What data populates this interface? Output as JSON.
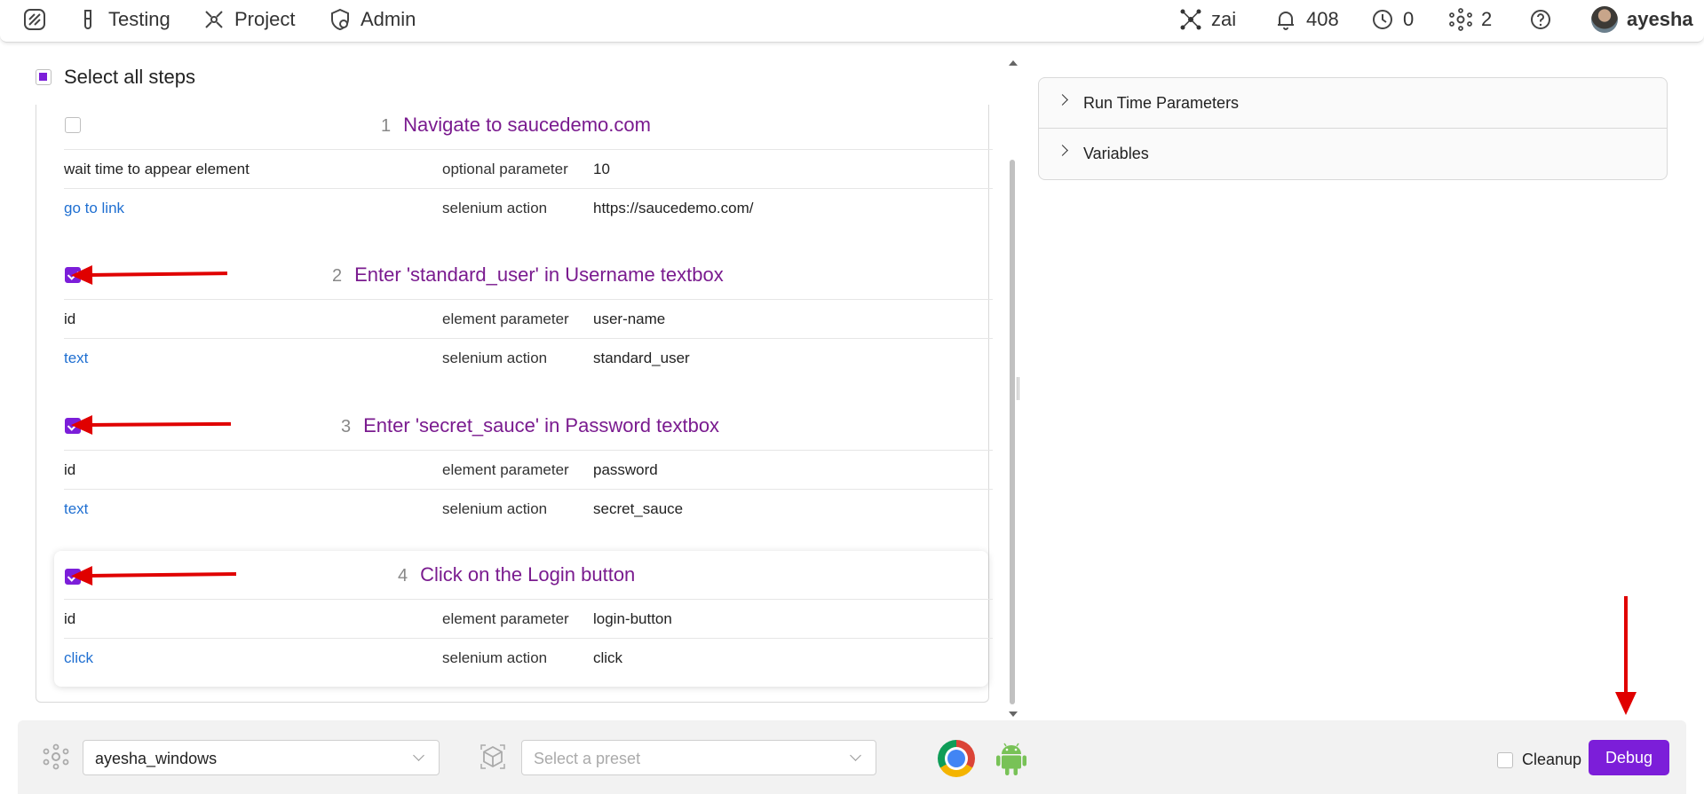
{
  "nav": {
    "testing_label": "Testing",
    "project_label": "Project",
    "admin_label": "Admin",
    "zai_label": "zai",
    "notifications_count": "408",
    "history_count": "0",
    "agents_count": "2",
    "user_name": "ayesha"
  },
  "steps_panel": {
    "select_all_label": "Select all steps",
    "steps": [
      {
        "number": "1",
        "title": "Navigate to saucedemo.com",
        "checked": false,
        "rows": [
          {
            "name": "wait time to appear element",
            "type": "optional parameter",
            "value": "10"
          },
          {
            "name": "go to link",
            "type": "selenium action",
            "value": "https://saucedemo.com/"
          }
        ]
      },
      {
        "number": "2",
        "title": "Enter 'standard_user' in Username textbox",
        "checked": true,
        "rows": [
          {
            "name": "id",
            "type": "element parameter",
            "value": "user-name"
          },
          {
            "name": "text",
            "type": "selenium action",
            "value": "standard_user"
          }
        ]
      },
      {
        "number": "3",
        "title": "Enter 'secret_sauce' in Password textbox",
        "checked": true,
        "rows": [
          {
            "name": "id",
            "type": "element parameter",
            "value": "password"
          },
          {
            "name": "text",
            "type": "selenium action",
            "value": "secret_sauce"
          }
        ]
      },
      {
        "number": "4",
        "title": "Click on the Login button",
        "checked": true,
        "rows": [
          {
            "name": "id",
            "type": "element parameter",
            "value": "login-button"
          },
          {
            "name": "click",
            "type": "selenium action",
            "value": "click"
          }
        ]
      }
    ]
  },
  "right_panel": {
    "sections": [
      "Run Time Parameters",
      "Variables"
    ]
  },
  "bottom_bar": {
    "agent_value": "ayesha_windows",
    "preset_placeholder": "Select a preset",
    "cleanup_label": "Cleanup",
    "debug_label": "Debug"
  },
  "colors": {
    "accent": "#7c1ed9",
    "step_title": "#7a1b8f",
    "link": "#1f6fd1",
    "annotation_arrow": "#e00000"
  },
  "icons": [
    "logo-icon",
    "flask-icon",
    "project-icon",
    "shield-icon",
    "network-icon",
    "bell-icon",
    "clock-icon",
    "agents-icon",
    "help-icon",
    "chrome-icon",
    "android-icon",
    "cube-icon"
  ]
}
